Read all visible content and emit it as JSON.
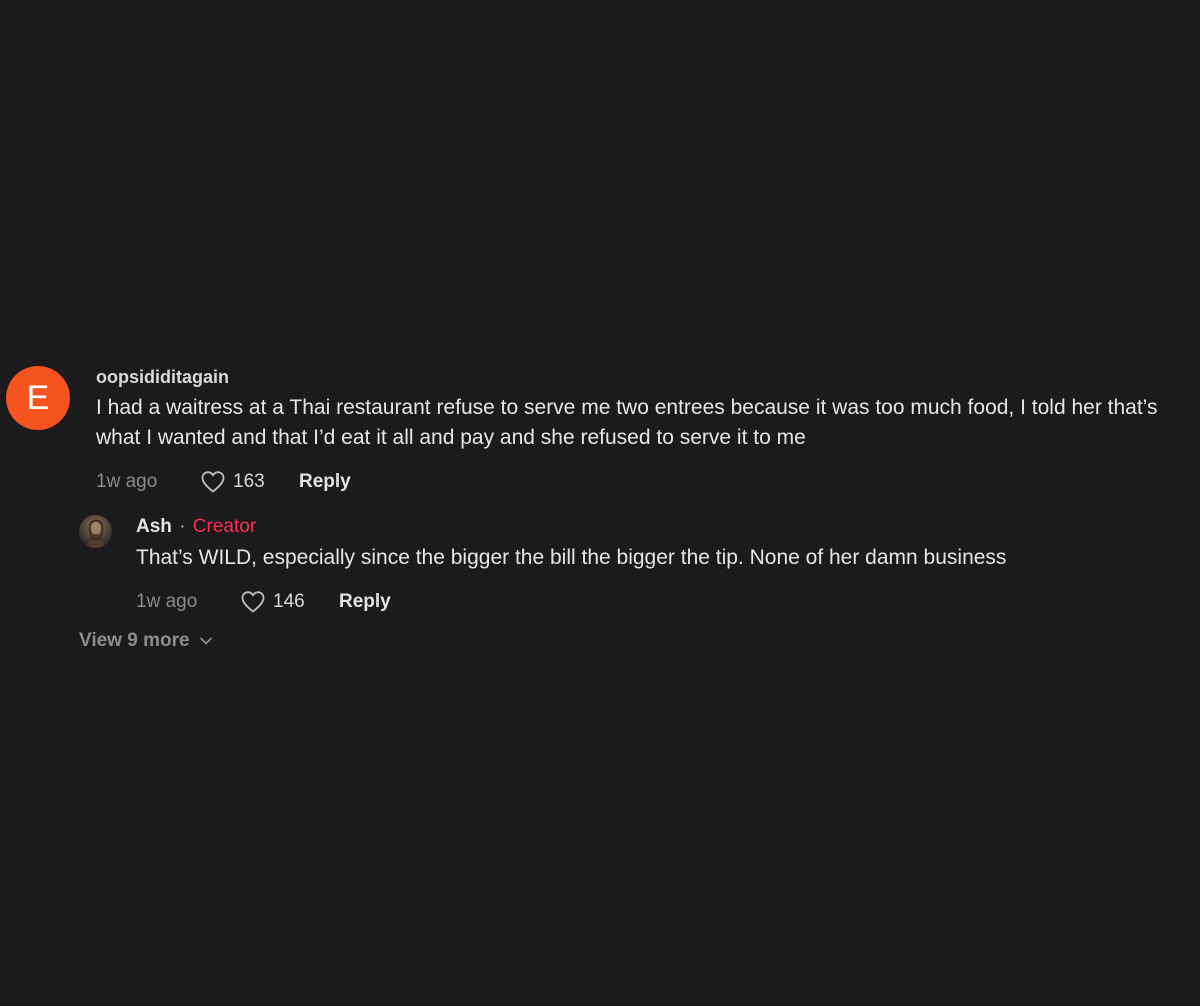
{
  "comment": {
    "avatar_letter": "E",
    "avatar_color": "#f5541f",
    "username": "oopsididitagain",
    "text": "I had a waitress at a Thai restaurant refuse to serve me two entrees because it was too much food, I told her that’s what I wanted and that I’d eat it all and pay and she refused to serve it to me",
    "time": "1w ago",
    "likes": "163",
    "reply_label": "Reply"
  },
  "reply": {
    "username": "Ash",
    "separator": "·",
    "badge": "Creator",
    "badge_color": "#fe2c55",
    "text": "That’s WILD, especially since the bigger the bill the bigger the tip. None of her damn business",
    "time": "1w ago",
    "likes": "146",
    "reply_label": "Reply"
  },
  "view_more": {
    "label": "View 9 more",
    "icon": "chevron-down-icon"
  }
}
